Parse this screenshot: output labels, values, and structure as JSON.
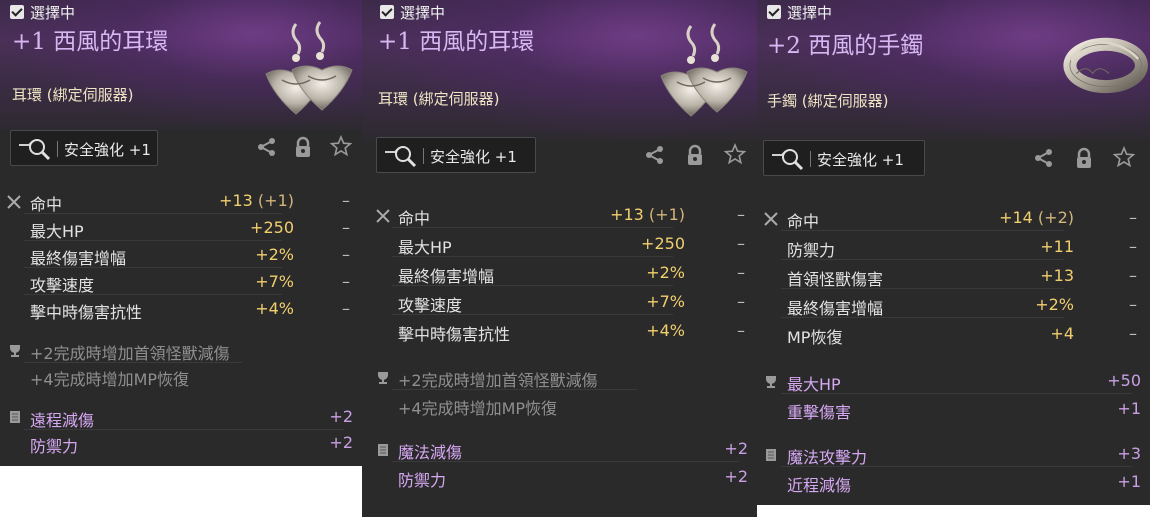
{
  "panels": [
    {
      "selected_label": "選擇中",
      "name": "+1 西風的耳環",
      "type": "耳環 (綁定伺服器)",
      "enhance_button": "安全強化 +1",
      "item_icon": "earring-icon",
      "stats": [
        {
          "label": "命中",
          "value": "+13",
          "bonus": "(+1)",
          "trend": "–"
        },
        {
          "label": "最大HP",
          "value": "+250",
          "bonus": "",
          "trend": "–"
        },
        {
          "label": "最終傷害增幅",
          "value": "+2%",
          "bonus": "",
          "trend": "–"
        },
        {
          "label": "攻擊速度",
          "value": "+7%",
          "bonus": "",
          "trend": "–"
        },
        {
          "label": "擊中時傷害抗性",
          "value": "+4%",
          "bonus": "",
          "trend": "–"
        }
      ],
      "set_bonuses": [
        "+2完成時增加首領怪獸減傷",
        "+4完成時增加MP恢復"
      ],
      "enchant_stats": [
        {
          "label": "遠程減傷",
          "value": "+2"
        },
        {
          "label": "防禦力",
          "value": "+2"
        }
      ]
    },
    {
      "selected_label": "選擇中",
      "name": "+1 西風的耳環",
      "type": "耳環 (綁定伺服器)",
      "enhance_button": "安全強化 +1",
      "item_icon": "earring-icon",
      "stats": [
        {
          "label": "命中",
          "value": "+13",
          "bonus": "(+1)",
          "trend": "–"
        },
        {
          "label": "最大HP",
          "value": "+250",
          "bonus": "",
          "trend": "–"
        },
        {
          "label": "最終傷害增幅",
          "value": "+2%",
          "bonus": "",
          "trend": "–"
        },
        {
          "label": "攻擊速度",
          "value": "+7%",
          "bonus": "",
          "trend": "–"
        },
        {
          "label": "擊中時傷害抗性",
          "value": "+4%",
          "bonus": "",
          "trend": "–"
        }
      ],
      "set_bonuses": [
        "+2完成時增加首領怪獸減傷",
        "+4完成時增加MP恢復"
      ],
      "enchant_stats": [
        {
          "label": "魔法減傷",
          "value": "+2"
        },
        {
          "label": "防禦力",
          "value": "+2"
        }
      ]
    },
    {
      "selected_label": "選擇中",
      "name": "+2 西風的手鐲",
      "type": "手鐲 (綁定伺服器)",
      "enhance_button": "安全強化 +1",
      "item_icon": "bracelet-icon",
      "stats": [
        {
          "label": "命中",
          "value": "+14",
          "bonus": "(+2)",
          "trend": "–"
        },
        {
          "label": "防禦力",
          "value": "+11",
          "bonus": "",
          "trend": "–"
        },
        {
          "label": "首領怪獸傷害",
          "value": "+13",
          "bonus": "",
          "trend": "–"
        },
        {
          "label": "最終傷害增幅",
          "value": "+2%",
          "bonus": "",
          "trend": "–"
        },
        {
          "label": "MP恢復",
          "value": "+4",
          "bonus": "",
          "trend": "–"
        }
      ],
      "set_stats": [
        {
          "label": "最大HP",
          "value": "+50"
        },
        {
          "label": "重擊傷害",
          "value": "+1"
        }
      ],
      "enchant_stats": [
        {
          "label": "魔法攻擊力",
          "value": "+3"
        },
        {
          "label": "近程減傷",
          "value": "+1"
        }
      ]
    }
  ]
}
